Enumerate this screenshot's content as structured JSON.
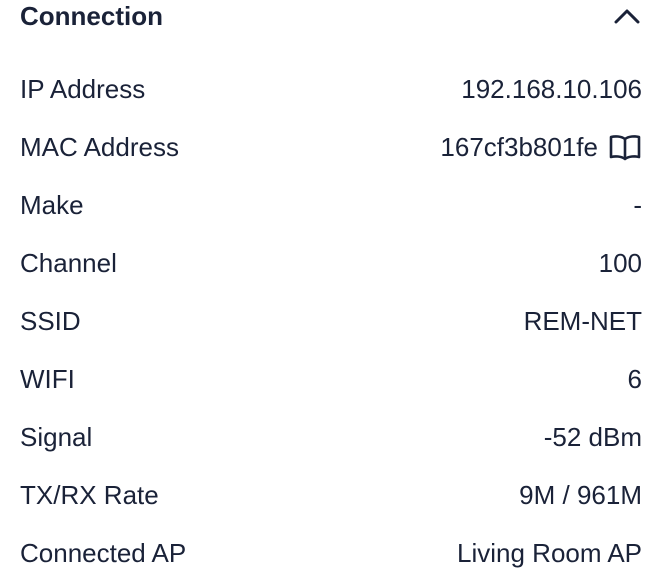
{
  "section": {
    "title": "Connection",
    "collapse_icon": "chevron-up-icon"
  },
  "rows": [
    {
      "label": "IP Address",
      "value": "192.168.10.106"
    },
    {
      "label": "MAC Address",
      "value": "167cf3b801fe",
      "icon": "book-icon"
    },
    {
      "label": "Make",
      "value": "-"
    },
    {
      "label": "Channel",
      "value": "100"
    },
    {
      "label": "SSID",
      "value": "REM-NET"
    },
    {
      "label": "WIFI",
      "value": "6"
    },
    {
      "label": "Signal",
      "value": "-52 dBm"
    },
    {
      "label": "TX/RX Rate",
      "value": "9M / 961M"
    },
    {
      "label": "Connected AP",
      "value": "Living Room AP"
    }
  ],
  "colors": {
    "text": "#1a2238",
    "background": "#ffffff"
  }
}
